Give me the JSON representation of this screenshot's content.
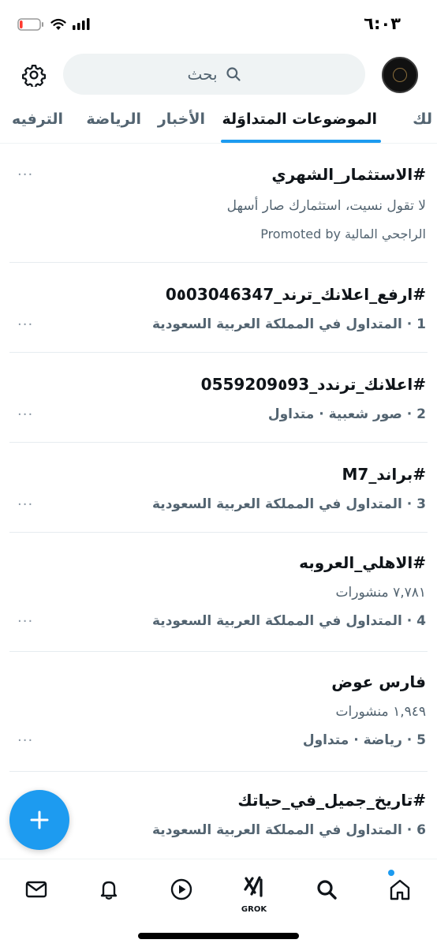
{
  "status_bar": {
    "time": "٦:٠٣",
    "battery_level": 0.15,
    "battery_color": "#ff3b30"
  },
  "header": {
    "search_placeholder": "بحث",
    "settings_icon": "gear-icon",
    "avatar_icon": "profile-avatar"
  },
  "tabs": [
    {
      "label": "لك",
      "active": false
    },
    {
      "label": "الموضوعات المتداوَلة",
      "active": true
    },
    {
      "label": "الأخبار",
      "active": false
    },
    {
      "label": "الرياضة",
      "active": false
    },
    {
      "label": "الترفيه",
      "active": false
    }
  ],
  "trends": [
    {
      "title": "#الاستثمار_الشهري",
      "line1": "لا تقول نسيت، استثمارك صار أسهل",
      "meta": "الراجحي المالية Promoted by",
      "meta_bold": false
    },
    {
      "title": "#ارفع_اعلانك_ترند_0٥03046347",
      "line1": "",
      "meta": "1 · المتداول في المملكة العربية السعودية",
      "meta_bold": true
    },
    {
      "title": "#اعلانك_ترندد_0559209٥93",
      "line1": "",
      "meta": "2 · صور شعبية · متداول",
      "meta_bold": true
    },
    {
      "title": "#براند_M7",
      "line1": "",
      "meta": "3 · المتداول في المملكة العربية السعودية",
      "meta_bold": true
    },
    {
      "title": "#الاهلي_العروبه",
      "line1": "٧,٧٨١ منشورات",
      "meta": "4 · المتداول في المملكة العربية السعودية",
      "meta_bold": true
    },
    {
      "title": "فارس عوض",
      "line1": "١,٩٤٩ منشورات",
      "meta": "5 · رياضة · متداول",
      "meta_bold": true
    },
    {
      "title": "#تاريخ_جميل_في_حياتك",
      "line1": "",
      "meta": "6 · المتداول في المملكة العربية السعودية",
      "meta_bold": true
    }
  ],
  "more_label": "···",
  "fab": {
    "icon": "plus-icon",
    "color": "#1d9bf0"
  },
  "bottom_nav": {
    "items": [
      "home-icon",
      "search-icon",
      "grok-icon",
      "video-icon",
      "bell-icon",
      "mail-icon"
    ],
    "grok_label": "GROK",
    "accent": "#1d9bf0"
  }
}
